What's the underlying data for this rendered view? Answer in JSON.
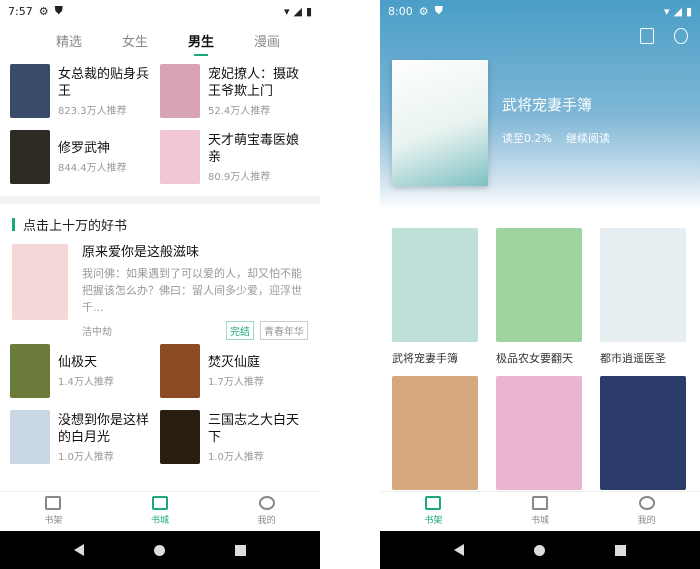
{
  "left": {
    "status": {
      "time": "7:57"
    },
    "tabs": [
      "精选",
      "女生",
      "男生",
      "漫画"
    ],
    "top_books": [
      {
        "title": "女总裁的贴身兵王",
        "meta": "823.3万人推荐",
        "color": "#3a4a6a"
      },
      {
        "title": "宠妃撩人：摄政王爷欺上门",
        "meta": "52.4万人推荐",
        "color": "#d9a3b6"
      },
      {
        "title": "修罗武神",
        "meta": "844.4万人推荐",
        "color": "#2c2a22"
      },
      {
        "title": "天才萌宝毒医娘亲",
        "meta": "80.9万人推荐",
        "color": "#f0c7d3"
      }
    ],
    "section_title": "点击上十万的好书",
    "featured": {
      "title": "原来爱你是这般滋味",
      "desc": "我问佛：如果遇到了可以爱的人，却又怕不能把握该怎么办？佛曰：留人间多少爱，迎浮世千...",
      "author": "洁中劫",
      "tags": [
        "完结",
        "青春年华"
      ],
      "color": "#f4d8d8"
    },
    "more_books": [
      {
        "title": "仙极天",
        "meta": "1.4万人推荐",
        "color": "#6a7b3a"
      },
      {
        "title": "焚灭仙庭",
        "meta": "1.7万人推荐",
        "color": "#8a4a22"
      },
      {
        "title": "没想到你是这样的白月光",
        "meta": "1.0万人推荐",
        "color": "#c9d6e4"
      },
      {
        "title": "三国志之大白天下",
        "meta": "1.0万人推荐",
        "color": "#2a1e12"
      }
    ],
    "nav": [
      "书架",
      "书城",
      "我的"
    ]
  },
  "right": {
    "status": {
      "time": "8:00"
    },
    "hero": {
      "title": "武将宠妻手簿",
      "progress": "读至0.2%",
      "continue": "继续阅读"
    },
    "shelf": [
      {
        "name": "武将宠妻手簿",
        "color": "#bfe0d8"
      },
      {
        "name": "极品农女要翻天",
        "color": "#9fd4a0"
      },
      {
        "name": "都市逍遥医圣",
        "color": "#e7eef2"
      },
      {
        "name": "",
        "color": "#d6a87e"
      },
      {
        "name": "",
        "color": "#e9b5cf"
      },
      {
        "name": "",
        "color": "#2b3c6b"
      }
    ],
    "nav": [
      "书架",
      "书城",
      "我的"
    ]
  }
}
